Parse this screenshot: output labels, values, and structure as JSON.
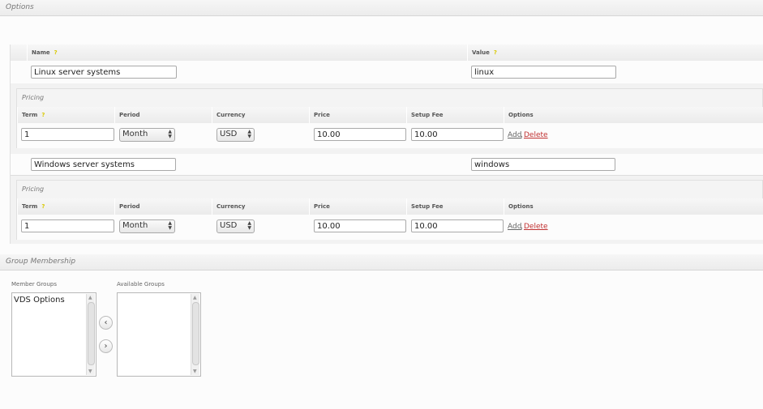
{
  "options_section": {
    "title": "Options"
  },
  "options_table": {
    "headers": {
      "name": "Name",
      "value": "Value"
    }
  },
  "options": [
    {
      "name": "Linux server systems",
      "value": "linux",
      "pricing": {
        "title": "Pricing",
        "headers": {
          "term": "Term",
          "period": "Period",
          "currency": "Currency",
          "price": "Price",
          "setup_fee": "Setup Fee",
          "options": "Options"
        },
        "row": {
          "term": "1",
          "period": "Month",
          "currency": "USD",
          "price": "10.00",
          "setup_fee": "10.00",
          "add": "Add",
          "sep": ",",
          "delete": "Delete"
        }
      }
    },
    {
      "name": "Windows server systems",
      "value": "windows",
      "pricing": {
        "title": "Pricing",
        "headers": {
          "term": "Term",
          "period": "Period",
          "currency": "Currency",
          "price": "Price",
          "setup_fee": "Setup Fee",
          "options": "Options"
        },
        "row": {
          "term": "1",
          "period": "Month",
          "currency": "USD",
          "price": "10.00",
          "setup_fee": "10.00",
          "add": "Add",
          "sep": ",",
          "delete": "Delete"
        }
      }
    }
  ],
  "group_section": {
    "title": "Group Membership",
    "member_label": "Member Groups",
    "available_label": "Available Groups",
    "member_items": [
      "VDS Options"
    ],
    "move_left": "‹",
    "move_right": "›"
  },
  "icons": {
    "help": "help-icon",
    "spinner": "spinner-icon"
  },
  "colors": {
    "delete_link": "#c03030",
    "help_icon": "#d8c800"
  }
}
